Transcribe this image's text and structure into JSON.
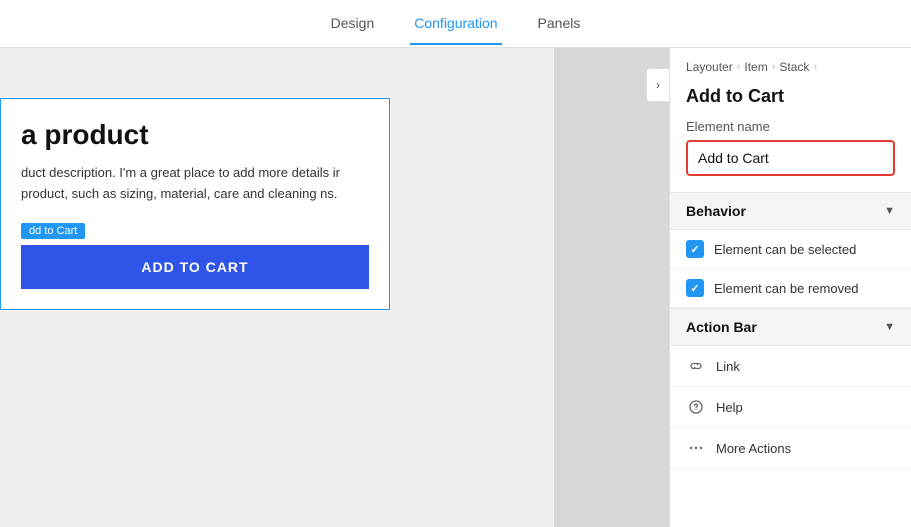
{
  "tabs": [
    {
      "label": "Design",
      "active": false
    },
    {
      "label": "Configuration",
      "active": true
    },
    {
      "label": "Panels",
      "active": false
    }
  ],
  "breadcrumb": {
    "items": [
      "Layouter",
      "Item",
      "Stack"
    ]
  },
  "panel": {
    "title": "Add to Cart",
    "element_name_label": "Element name",
    "element_name_value": "Add to Cart",
    "behavior_label": "Behavior",
    "checkbox_selected_label": "Element can be selected",
    "checkbox_removed_label": "Element can be removed",
    "action_bar_label": "Action Bar",
    "action_items": [
      {
        "icon": "link-icon",
        "label": "Link"
      },
      {
        "icon": "help-icon",
        "label": "Help"
      },
      {
        "icon": "more-icon",
        "label": "More Actions"
      }
    ]
  },
  "preview": {
    "product_title": "a product",
    "product_desc": "duct description. I'm a great place to add more details ir product, such as sizing, material, care and cleaning ns.",
    "add_to_cart_badge": "dd to Cart",
    "add_to_cart_button": "ADD TO CART"
  },
  "toggle_arrow": "›",
  "colors": {
    "active_tab": "#2196F3",
    "checkbox_bg": "#2196F3",
    "input_border": "#e53935",
    "button_bg": "#2E54E8"
  }
}
